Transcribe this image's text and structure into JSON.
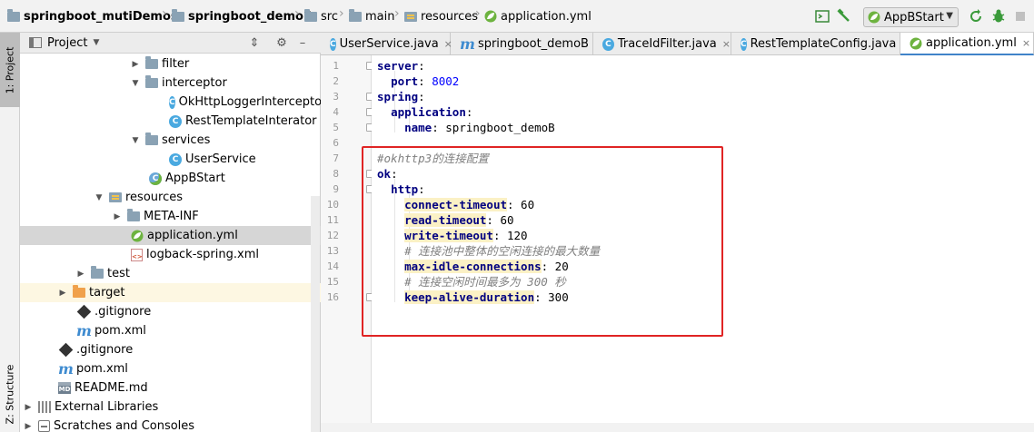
{
  "breadcrumb": {
    "items": [
      {
        "label": "springboot_mutiDemos",
        "icon": "folder-icon"
      },
      {
        "label": "springboot_demoB",
        "icon": "folder-icon"
      },
      {
        "label": "src",
        "icon": "folder-icon"
      },
      {
        "label": "main",
        "icon": "folder-icon"
      },
      {
        "label": "resources",
        "icon": "resources-folder-icon"
      },
      {
        "label": "application.yml",
        "icon": "spring-leaf-icon"
      }
    ],
    "separator": "›"
  },
  "toolbar": {
    "run_config": "AppBStart",
    "icons": [
      "terminal-icon",
      "build-hammer-icon",
      "spring-leaf-icon",
      "rerun-icon",
      "debug-bug-icon"
    ]
  },
  "left_stripe": {
    "project_tab": "1: Project",
    "structure_tab": "Z: Structure"
  },
  "project_panel": {
    "title": "Project",
    "tree": [
      {
        "label": "filter",
        "icon": "folder",
        "arrow": "▶"
      },
      {
        "label": "interceptor",
        "icon": "folder",
        "arrow": "▼"
      },
      {
        "label": "OkHttpLoggerInterceptor",
        "icon": "class",
        "arrow": ""
      },
      {
        "label": "RestTemplateInterator",
        "icon": "class",
        "arrow": ""
      },
      {
        "label": "services",
        "icon": "folder",
        "arrow": "▼"
      },
      {
        "label": "UserService",
        "icon": "class",
        "arrow": ""
      },
      {
        "label": "AppBStart",
        "icon": "spring-class",
        "arrow": ""
      },
      {
        "label": "resources",
        "icon": "resources",
        "arrow": "▼"
      },
      {
        "label": "META-INF",
        "icon": "folder",
        "arrow": "▶"
      },
      {
        "label": "application.yml",
        "icon": "spring-leaf",
        "arrow": ""
      },
      {
        "label": "logback-spring.xml",
        "icon": "xml",
        "arrow": ""
      },
      {
        "label": "test",
        "icon": "folder",
        "arrow": "▶"
      },
      {
        "label": "target",
        "icon": "folder-orange",
        "arrow": "▶"
      },
      {
        "label": ".gitignore",
        "icon": "git",
        "arrow": ""
      },
      {
        "label": "pom.xml",
        "icon": "maven",
        "arrow": ""
      },
      {
        "label": ".gitignore",
        "icon": "git",
        "arrow": ""
      },
      {
        "label": "pom.xml",
        "icon": "maven",
        "arrow": ""
      },
      {
        "label": "README.md",
        "icon": "md",
        "arrow": ""
      },
      {
        "label": "External Libraries",
        "icon": "ext-lib",
        "arrow": "▶"
      },
      {
        "label": "Scratches and Consoles",
        "icon": "scratch",
        "arrow": "▶"
      }
    ]
  },
  "editor": {
    "tabs": [
      {
        "label": "UserService.java",
        "icon": "class"
      },
      {
        "label": "springboot_demoB",
        "icon": "maven"
      },
      {
        "label": "TraceIdFilter.java",
        "icon": "class"
      },
      {
        "label": "RestTemplateConfig.java",
        "icon": "class"
      },
      {
        "label": "application.yml",
        "icon": "spring-leaf"
      }
    ],
    "close_glyph": "×",
    "lines": [
      {
        "n": "1",
        "parts": [
          [
            "k",
            "server"
          ],
          [
            "s",
            ":"
          ]
        ]
      },
      {
        "n": "2",
        "parts": [
          [
            "s",
            "  "
          ],
          [
            "k",
            "port"
          ],
          [
            "s",
            ": "
          ],
          [
            "v",
            "8002"
          ]
        ]
      },
      {
        "n": "3",
        "parts": [
          [
            "k",
            "spring"
          ],
          [
            "s",
            ":"
          ]
        ]
      },
      {
        "n": "4",
        "parts": [
          [
            "s",
            "  "
          ],
          [
            "k",
            "application"
          ],
          [
            "s",
            ":"
          ]
        ]
      },
      {
        "n": "5",
        "parts": [
          [
            "s",
            "    "
          ],
          [
            "k",
            "name"
          ],
          [
            "s",
            ": springboot_demoB"
          ]
        ]
      },
      {
        "n": "6",
        "parts": []
      },
      {
        "n": "7",
        "parts": [
          [
            "cm",
            "#okhttp3的连接配置"
          ]
        ]
      },
      {
        "n": "8",
        "parts": [
          [
            "k",
            "ok"
          ],
          [
            "s",
            ":"
          ]
        ]
      },
      {
        "n": "9",
        "parts": [
          [
            "s",
            "  "
          ],
          [
            "k",
            "http"
          ],
          [
            "s",
            ":"
          ]
        ]
      },
      {
        "n": "10",
        "parts": [
          [
            "s",
            "    "
          ],
          [
            "kh",
            "connect-timeout"
          ],
          [
            "s",
            ": 60"
          ]
        ]
      },
      {
        "n": "11",
        "parts": [
          [
            "s",
            "    "
          ],
          [
            "kh",
            "read-timeout"
          ],
          [
            "s",
            ": 60"
          ]
        ]
      },
      {
        "n": "12",
        "parts": [
          [
            "s",
            "    "
          ],
          [
            "kh",
            "write-timeout"
          ],
          [
            "s",
            ": 120"
          ]
        ]
      },
      {
        "n": "13",
        "parts": [
          [
            "s",
            "    "
          ],
          [
            "cm",
            "# 连接池中整体的空闲连接的最大数量"
          ]
        ]
      },
      {
        "n": "14",
        "parts": [
          [
            "s",
            "    "
          ],
          [
            "kh",
            "max-idle-connections"
          ],
          [
            "s",
            ": 20"
          ]
        ]
      },
      {
        "n": "15",
        "parts": [
          [
            "s",
            "    "
          ],
          [
            "cm",
            "# 连接空闲时间最多为 300 秒"
          ]
        ]
      },
      {
        "n": "16",
        "parts": [
          [
            "s",
            "    "
          ],
          [
            "kh",
            "keep-alive-duration"
          ],
          [
            "s",
            ": 300"
          ]
        ]
      }
    ]
  },
  "colors": {
    "annotation_box": "#e02424",
    "selection": "#d6d6d6",
    "key": "#000080",
    "number": "#0000ff",
    "comment": "#808080"
  }
}
